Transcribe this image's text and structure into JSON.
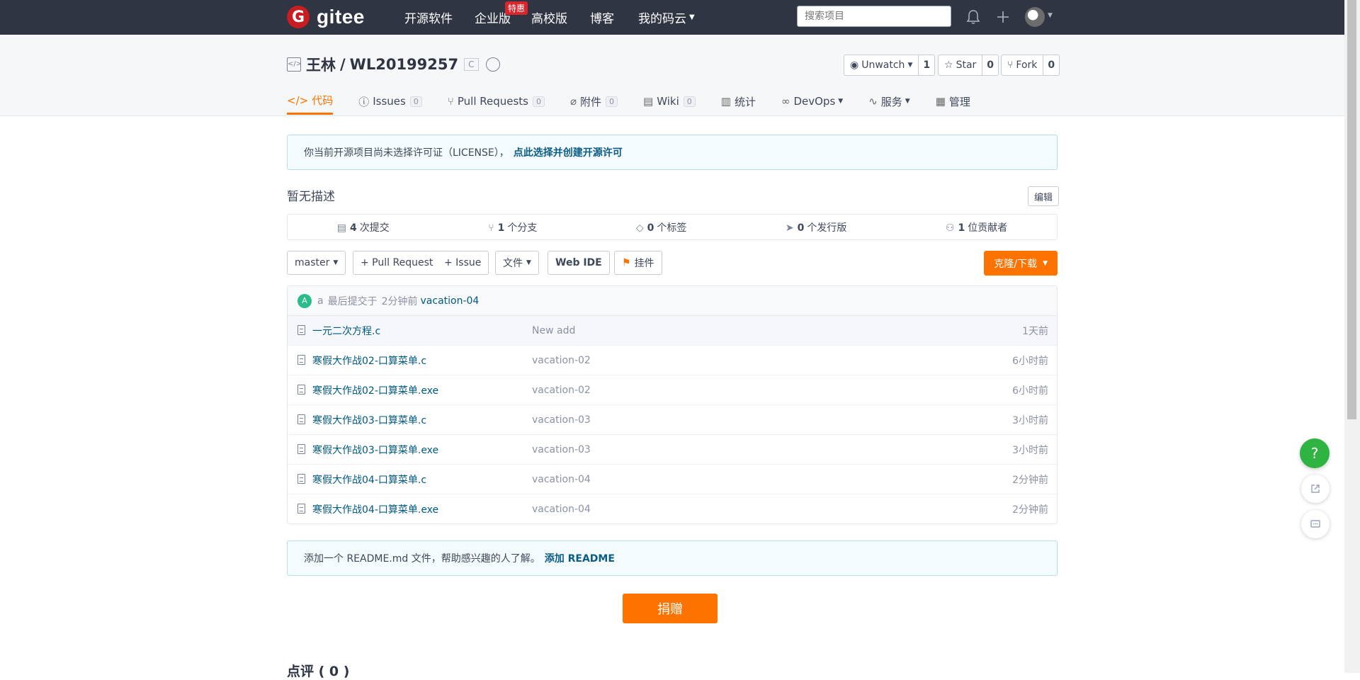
{
  "topbar": {
    "logo_text": "gitee",
    "nav": [
      "开源软件",
      "企业版",
      "高校版",
      "博客",
      "我的码云"
    ],
    "special_badge": "特惠",
    "search_placeholder": "搜索项目"
  },
  "repo": {
    "owner": "王林",
    "separator": "/",
    "name": "WL20199257",
    "lang": "C",
    "watch": {
      "label": "Unwatch",
      "count": "1"
    },
    "star": {
      "label": "Star",
      "count": "0"
    },
    "fork": {
      "label": "Fork",
      "count": "0"
    }
  },
  "tabs": [
    {
      "label": "代码"
    },
    {
      "label": "Issues",
      "count": "0"
    },
    {
      "label": "Pull Requests",
      "count": "0"
    },
    {
      "label": "附件",
      "count": "0"
    },
    {
      "label": "Wiki",
      "count": "0"
    },
    {
      "label": "统计"
    },
    {
      "label": "DevOps"
    },
    {
      "label": "服务"
    },
    {
      "label": "管理"
    }
  ],
  "license_notice": {
    "text": "你当前开源项目尚未选择许可证（LICENSE），",
    "link": "点此选择并创建开源许可"
  },
  "description": "暂无描述",
  "edit_label": "编辑",
  "stats": [
    {
      "value": "4",
      "label": "次提交"
    },
    {
      "value": "1",
      "label": "个分支"
    },
    {
      "value": "0",
      "label": "个标签"
    },
    {
      "value": "0",
      "label": "个发行版"
    },
    {
      "value": "1",
      "label": "位贡献者"
    }
  ],
  "toolbar": {
    "branch": "master",
    "pull_request": "+ Pull Request",
    "issue": "+ Issue",
    "file": "文件",
    "web_ide": "Web IDE",
    "widget": "挂件",
    "clone": "克隆/下载"
  },
  "last_commit": {
    "avatar_letter": "A",
    "author": "a",
    "text": "最后提交于",
    "time": "2分钟前",
    "message": "vacation-04"
  },
  "files": [
    {
      "name": "一元二次方程.c",
      "msg": "New add",
      "time": "1天前"
    },
    {
      "name": "寒假大作战02-口算菜单.c",
      "msg": "vacation-02",
      "time": "6小时前"
    },
    {
      "name": "寒假大作战02-口算菜单.exe",
      "msg": "vacation-02",
      "time": "6小时前"
    },
    {
      "name": "寒假大作战03-口算菜单.c",
      "msg": "vacation-03",
      "time": "3小时前"
    },
    {
      "name": "寒假大作战03-口算菜单.exe",
      "msg": "vacation-03",
      "time": "3小时前"
    },
    {
      "name": "寒假大作战04-口算菜单.c",
      "msg": "vacation-04",
      "time": "2分钟前"
    },
    {
      "name": "寒假大作战04-口算菜单.exe",
      "msg": "vacation-04",
      "time": "2分钟前"
    }
  ],
  "readme_notice": {
    "text": "添加一个 README.md 文件，帮助感兴趣的人了解。",
    "link": "添加 README"
  },
  "donate": "捐赠",
  "review": "点评 ( 0 )",
  "help": "?"
}
